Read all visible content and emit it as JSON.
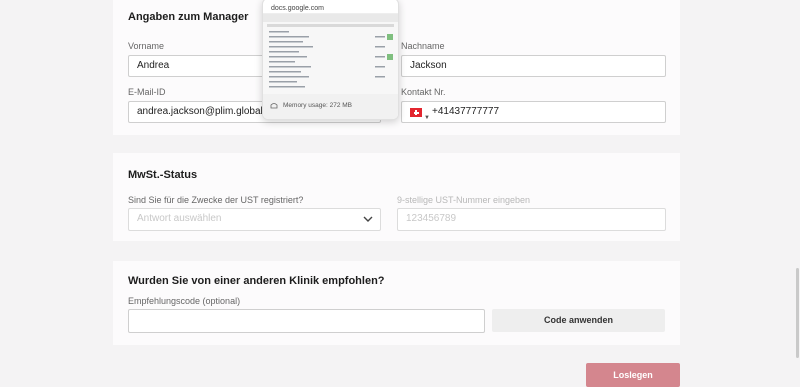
{
  "manager": {
    "title": "Angaben zum Manager",
    "first_name_label": "Vorname",
    "first_name_value": "Andrea",
    "last_name_label": "Nachname",
    "last_name_value": "Jackson",
    "email_label": "E-Mail-ID",
    "email_value": "andrea.jackson@plim.global",
    "phone_label": "Kontakt Nr.",
    "phone_value": "+41437777777",
    "phone_flag_icon": "swiss-flag-icon"
  },
  "vat": {
    "title": "MwSt.-Status",
    "question_label": "Sind Sie für die Zwecke der UST registriert?",
    "answer_placeholder": "Antwort auswählen",
    "number_label": "9-stellige UST-Nummer eingeben",
    "number_placeholder": "123456789"
  },
  "referral": {
    "title": "Wurden Sie von einer anderen Klinik empfohlen?",
    "code_label": "Empfehlungscode (optional)",
    "code_value": "",
    "apply_button": "Code anwenden"
  },
  "start_button": "Loslegen",
  "tab_preview": {
    "domain": "docs.google.com",
    "memory": "Memory usage: 272 MB"
  },
  "colors": {
    "primary_button": "#d4868e",
    "page_background": "#f4f3f4",
    "card_background": "#fcfbfc"
  }
}
